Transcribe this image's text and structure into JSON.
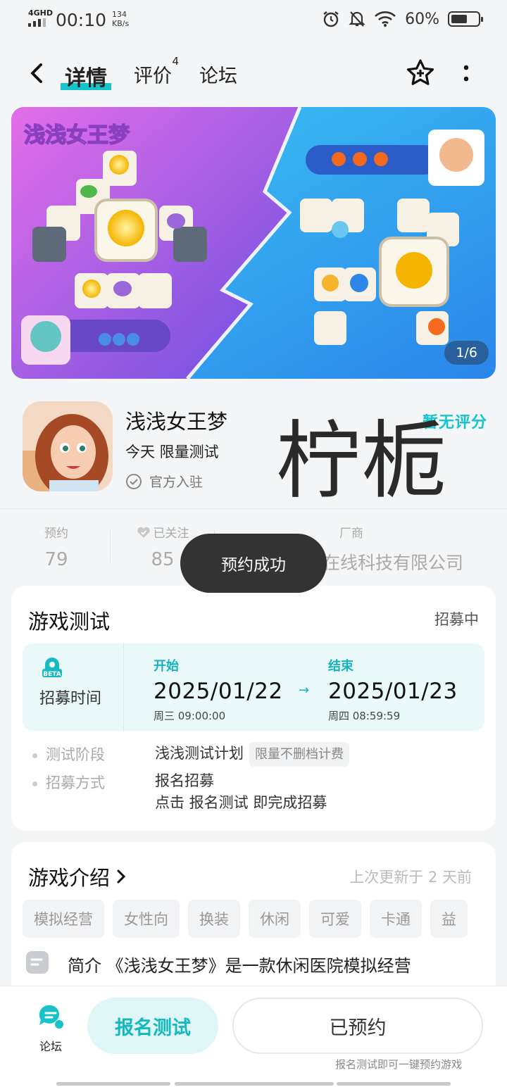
{
  "status_bar": {
    "network": "4GHD",
    "time": "00:10",
    "speed_value": "134",
    "speed_unit": "KB/s",
    "battery": "60%"
  },
  "nav": {
    "tabs": [
      {
        "label": "详情",
        "active": true
      },
      {
        "label": "评价",
        "badge": "4"
      },
      {
        "label": "论坛"
      }
    ]
  },
  "banner": {
    "pager": "1/6",
    "logo_text": "浅浅女王梦"
  },
  "app": {
    "name": "浅浅女王梦",
    "release": "今天 限量测试",
    "official": "官方入驻",
    "rating": "暂无评分"
  },
  "watermark": "柠栀",
  "stats": {
    "reserve": {
      "label": "预约",
      "value": "79"
    },
    "follow": {
      "label": "已关注",
      "value": "85"
    },
    "vendor": {
      "label": "厂商",
      "value": "在线科技有限公司"
    }
  },
  "toast": "预约成功",
  "game_test": {
    "title": "游戏测试",
    "status": "招募中",
    "recruit_label": "招募时间",
    "start": {
      "tag": "开始",
      "date": "2025/01/22",
      "sub": "周三  09:00:00"
    },
    "end": {
      "tag": "结束",
      "date": "2025/01/23",
      "sub": "周四  08:59:59"
    },
    "arrow": "→",
    "stage_label": "测试阶段",
    "stage_value": "浅浅测试计划",
    "stage_pill": "限量不删档计费",
    "method_label": "招募方式",
    "method_value_1": "报名招募",
    "method_value_2": "点击 报名测试 即完成招募"
  },
  "intro": {
    "title": "游戏介绍",
    "updated": "上次更新于 2 天前",
    "tags": [
      "模拟经营",
      "女性向",
      "换装",
      "休闲",
      "可爱",
      "卡通",
      "益"
    ],
    "text": "简介 《浅浅女王梦》是一款休闲医院模拟经营"
  },
  "bottom": {
    "forum": "论坛",
    "signup": "报名测试",
    "reserved": "已预约",
    "hint": "报名测试即可一键预约游戏"
  },
  "colors": {
    "accent": "#15c5ce",
    "background": "#f3f5f6",
    "toast": "#333333"
  }
}
